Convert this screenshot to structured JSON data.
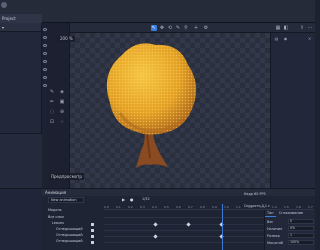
{
  "window": {
    "tab": "Project"
  },
  "canvas": {
    "zoom": "200 %",
    "preview_label": "Предпросмотр"
  },
  "topbar_right": {
    "fps": "Кадр 60 FPS",
    "loop": "Цикл 0,1 c"
  },
  "anim": {
    "title": "Анимация",
    "select_value": "New animation",
    "frame_value": "1/32",
    "fps_label": "Кадр 60 FPS",
    "speed_label": "Скорость  0,1 c",
    "rows": [
      "Модель",
      "Все слои",
      "Leaves",
      "Огнедышащий",
      "Огнедышащий",
      "Огнедышащий"
    ],
    "ticks": [
      "0.0",
      "0.1",
      "0.2",
      "0.3",
      "0.4",
      "0.5",
      "0.6",
      "0.7",
      "0.8",
      "0.9",
      "1.0",
      "1.1",
      "1.2",
      "1.3",
      "1.4",
      "1.5",
      "1.6",
      "1.7"
    ]
  },
  "props": {
    "tab1": "Тип",
    "tab2": "Сглаживание",
    "fields": [
      {
        "label": "Вес",
        "value": "0"
      },
      {
        "label": "Наличие",
        "value": "0%"
      },
      {
        "label": "Размер",
        "value": "1"
      },
      {
        "label": "Масштаб",
        "value": "100%"
      }
    ]
  }
}
